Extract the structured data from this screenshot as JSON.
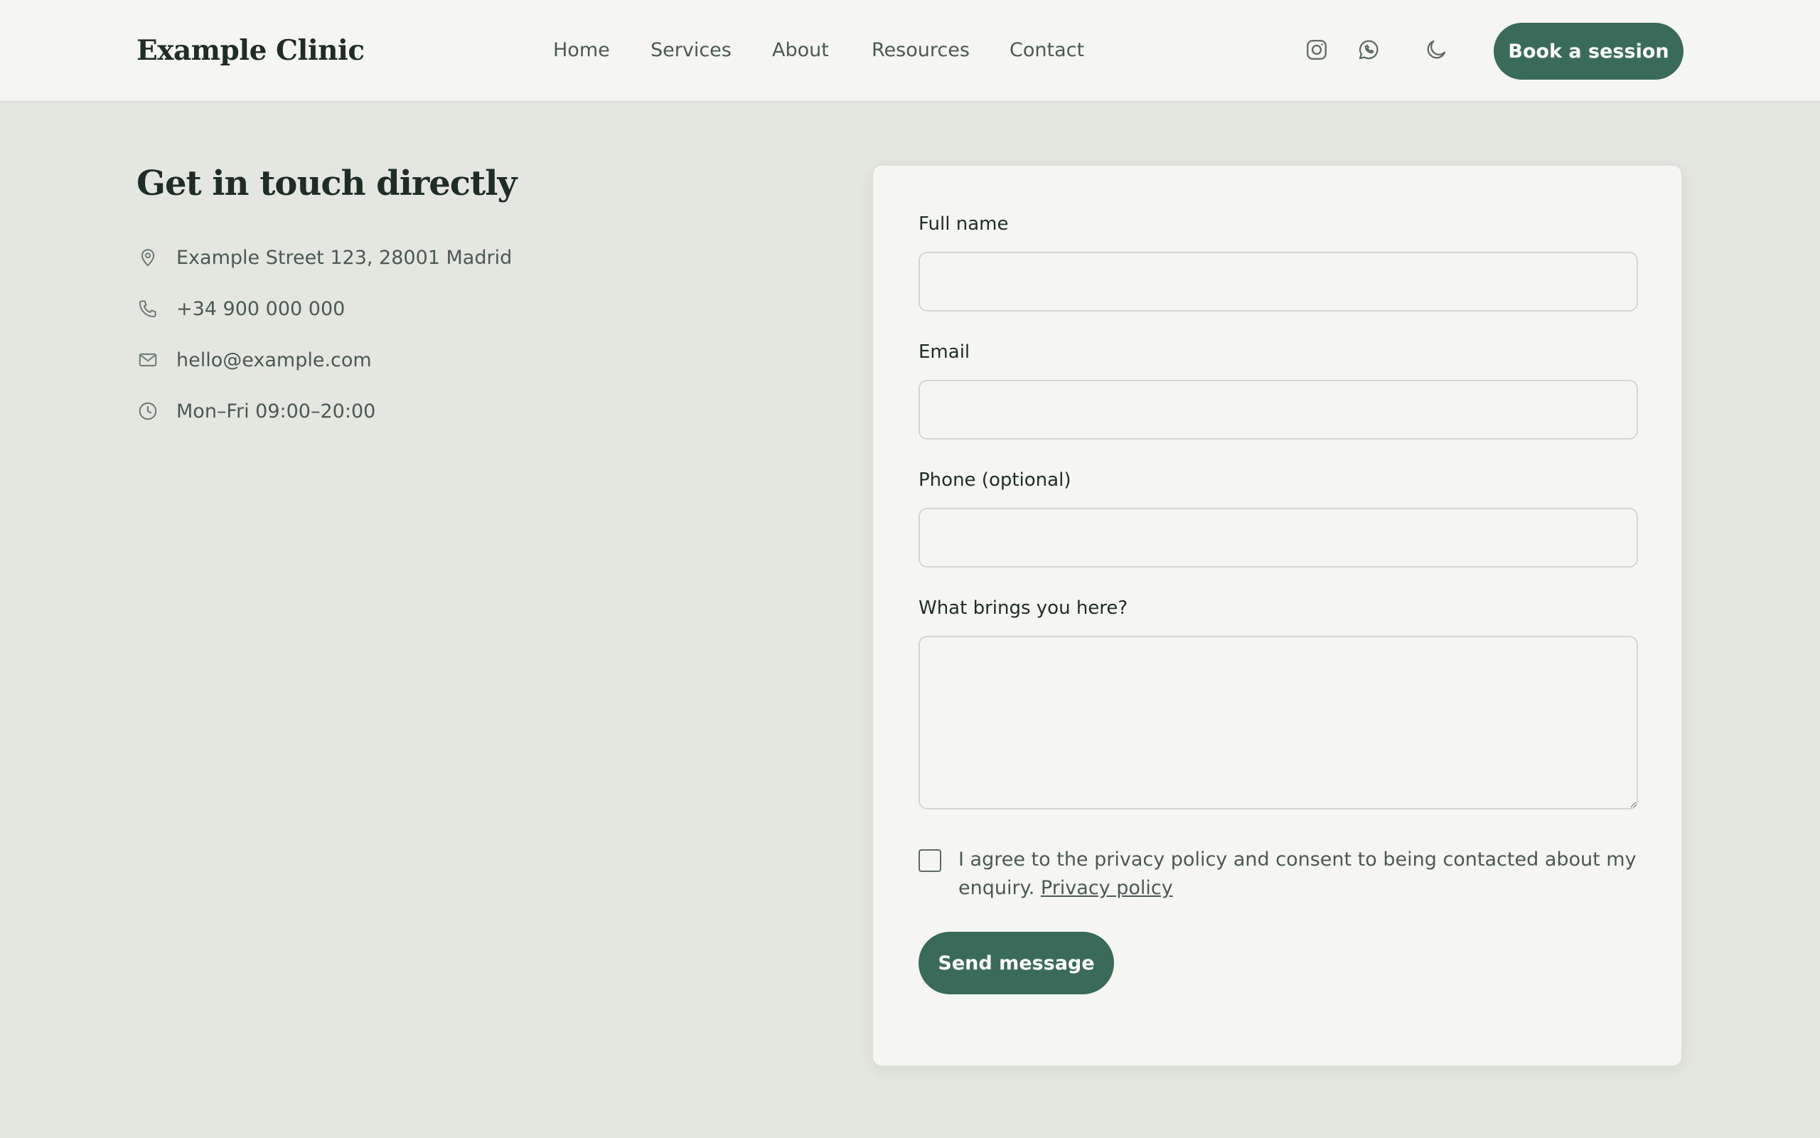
{
  "header": {
    "brand": "Example Clinic",
    "nav": [
      "Home",
      "Services",
      "About",
      "Resources",
      "Contact"
    ],
    "icons": [
      "instagram-icon",
      "whatsapp-icon",
      "moon-icon"
    ],
    "cta_label": "Book a session"
  },
  "contact": {
    "title": "Get in touch directly",
    "items": [
      {
        "icon": "location-pin-icon",
        "text": "Example Street 123, 28001 Madrid"
      },
      {
        "icon": "phone-icon",
        "text": "+34 900 000 000"
      },
      {
        "icon": "mail-icon",
        "text": "hello@example.com"
      },
      {
        "icon": "clock-icon",
        "text": "Mon–Fri 09:00–20:00"
      }
    ]
  },
  "form": {
    "fields": [
      {
        "label": "Full name",
        "value": "",
        "placeholder": ""
      },
      {
        "label": "Email",
        "value": "",
        "placeholder": ""
      },
      {
        "label": "Phone (optional)",
        "value": "",
        "placeholder": ""
      }
    ],
    "message_label": "What brings you here?",
    "message_value": "",
    "consent_text": "I agree to the privacy policy and consent to being contacted about my enquiry.",
    "consent_link": "Privacy policy",
    "consent_checked": false,
    "submit_label": "Send message"
  },
  "colors": {
    "accent": "#3a6b5a",
    "page_bg": "#e4e7df",
    "header_bg": "#f5f5f2",
    "card_bg": "#f5f5f2",
    "heading": "#1f2d27",
    "body_text": "#4a5a52"
  }
}
